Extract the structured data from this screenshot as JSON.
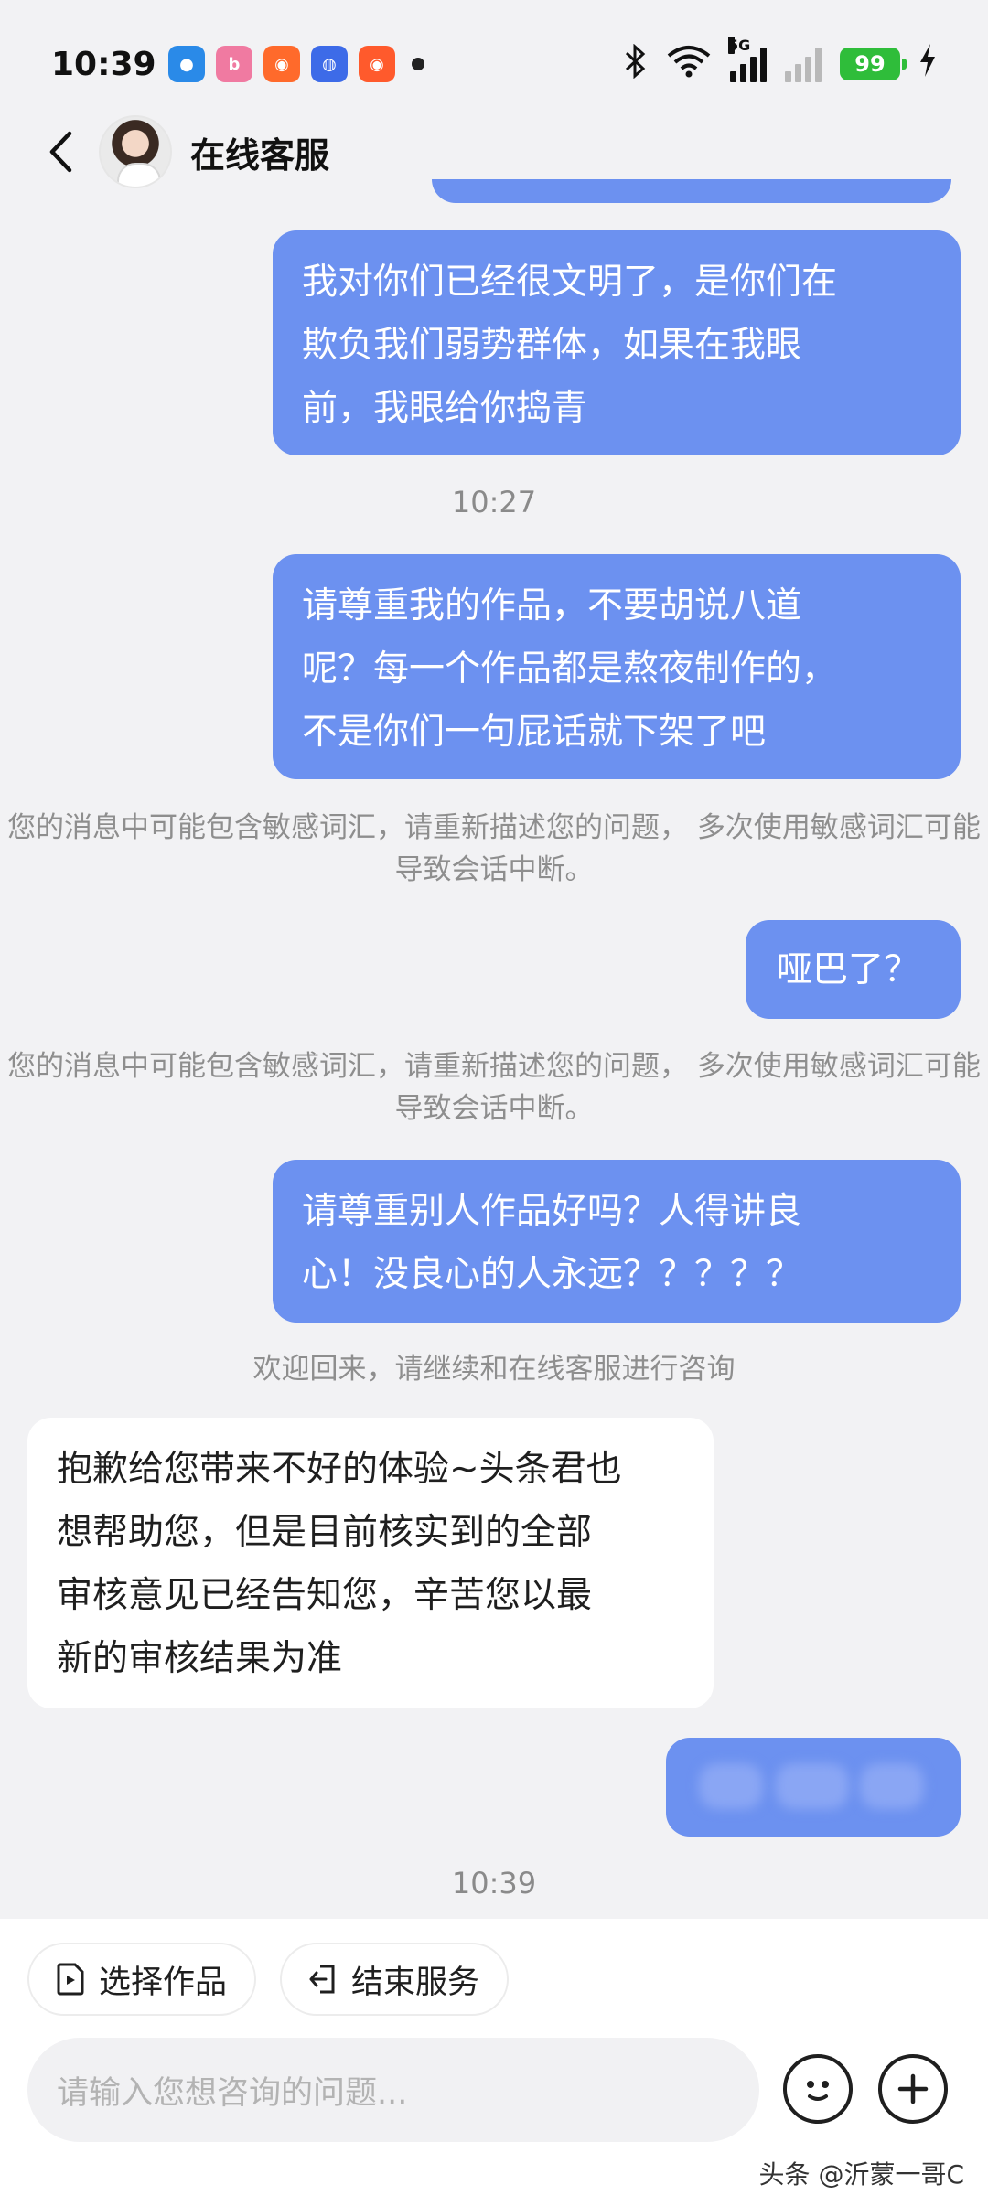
{
  "status_bar": {
    "time": "10:39",
    "notification_icons": [
      {
        "name": "app-notification-1-icon",
        "color": "#2a8ae8",
        "glyph": "●"
      },
      {
        "name": "bilibili-icon",
        "color": "#f07aa1",
        "glyph": "b"
      },
      {
        "name": "app-notification-3-icon",
        "color": "#ff6a2b",
        "glyph": "◉"
      },
      {
        "name": "baidu-icon",
        "color": "#3d6be8",
        "glyph": "◍"
      },
      {
        "name": "app-notification-5-icon",
        "color": "#ff5a2c",
        "glyph": "◉"
      }
    ],
    "network": "5G",
    "battery": "99"
  },
  "header": {
    "title": "在线客服"
  },
  "messages": {
    "out_1": "我对你们已经很文明了，是你们在\n欺负我们弱势群体，如果在我眼\n前，我眼给你捣青",
    "time_1": "10:27",
    "out_2": "请尊重我的作品，不要胡说八道\n呢？每一个作品都是熬夜制作的，\n不是你们一句屁话就下架了吧",
    "notice_1": "您的消息中可能包含敏感词汇，请重新描述您的问题，\n多次使用敏感词汇可能导致会话中断。",
    "out_3": "哑巴了？",
    "notice_2": "您的消息中可能包含敏感词汇，请重新描述您的问题，\n多次使用敏感词汇可能导致会话中断。",
    "out_4": "请尊重别人作品好吗？人得讲良\n心！没良心的人永远？？？？？",
    "notice_3": "欢迎回来，请继续和在线客服进行咨询",
    "in_1": "抱歉给您带来不好的体验~头条君也\n想帮助您，但是目前核实到的全部\n审核意见已经告知您，辛苦您以最\n新的审核结果为准",
    "out_5_blurred": "",
    "time_2": "10:39"
  },
  "actions": {
    "select_work": "选择作品",
    "end_service": "结束服务"
  },
  "input": {
    "placeholder": "请输入您想咨询的问题..."
  },
  "watermark": "头条 @沂蒙一哥C",
  "colors": {
    "out_bubble": "#6c91f0",
    "background": "#f2f2f4"
  }
}
